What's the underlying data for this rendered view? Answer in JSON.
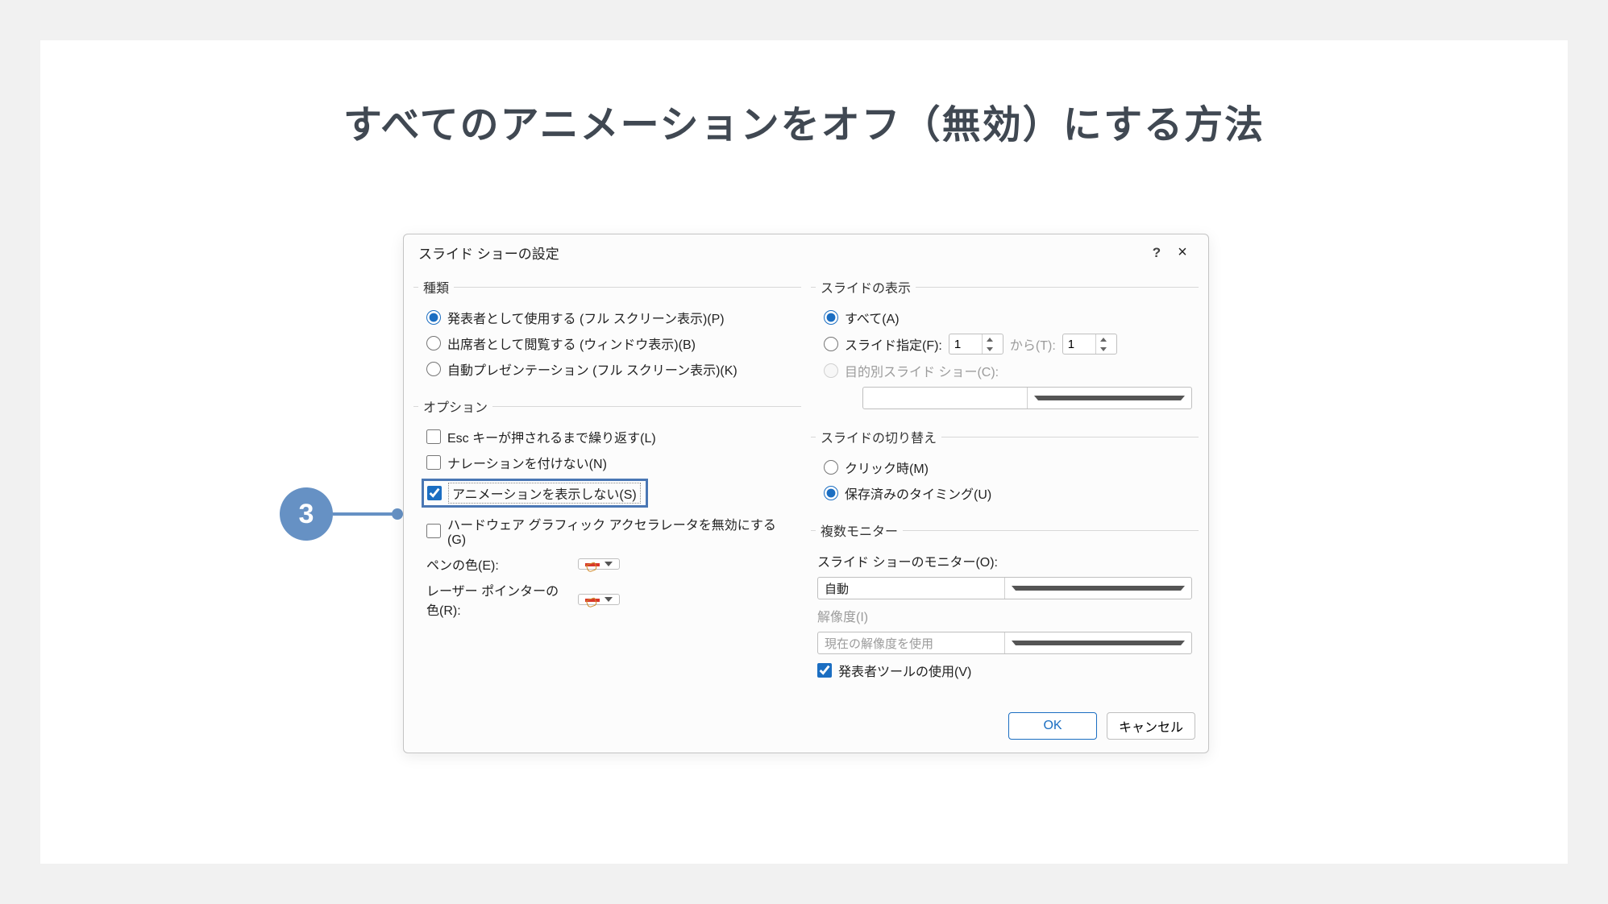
{
  "page": {
    "title": "すべてのアニメーションをオフ（無効）にする方法"
  },
  "step": {
    "number": "3"
  },
  "dialog": {
    "title": "スライド ショーの設定",
    "help": "?",
    "close": "×",
    "groups": {
      "type": {
        "legend": "種類",
        "opt_presenter": "発表者として使用する (フル スクリーン表示)(P)",
        "opt_browse": "出席者として閲覧する (ウィンドウ表示)(B)",
        "opt_kiosk": "自動プレゼンテーション (フル スクリーン表示)(K)"
      },
      "options": {
        "legend": "オプション",
        "loop": "Esc キーが押されるまで繰り返す(L)",
        "narration": "ナレーションを付けない(N)",
        "animation": "アニメーションを表示しない(S)",
        "hardware": "ハードウェア グラフィック アクセラレータを無効にする(G)",
        "pen_label": "ペンの色(E):",
        "laser_label": "レーザー ポインターの色(R):"
      },
      "slides": {
        "legend": "スライドの表示",
        "all": "すべて(A)",
        "range": "スライド指定(F):",
        "to": "から(T):",
        "from_value": "1",
        "to_value": "1",
        "custom": "目的別スライド ショー(C):"
      },
      "advance": {
        "legend": "スライドの切り替え",
        "manual": "クリック時(M)",
        "timing": "保存済みのタイミング(U)"
      },
      "monitors": {
        "legend": "複数モニター",
        "monitor_label": "スライド ショーのモニター(O):",
        "monitor_value": "自動",
        "resolution_label": "解像度(I)",
        "resolution_value": "現在の解像度を使用",
        "presenter_view": "発表者ツールの使用(V)"
      }
    },
    "buttons": {
      "ok": "OK",
      "cancel": "キャンセル"
    }
  }
}
